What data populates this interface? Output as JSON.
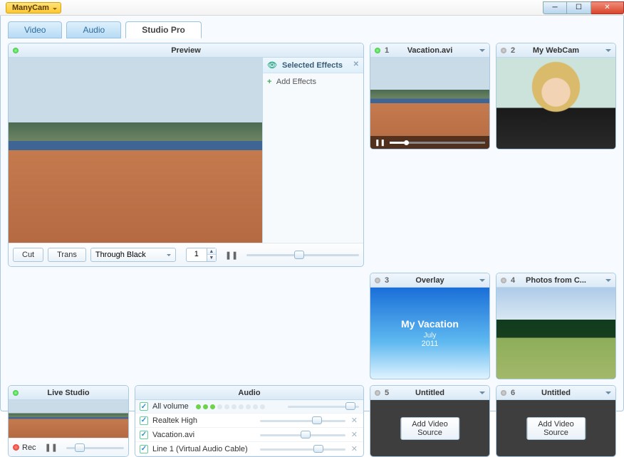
{
  "app": {
    "menu_label": "ManyCam"
  },
  "tabs": [
    {
      "label": "Video",
      "active": false
    },
    {
      "label": "Audio",
      "active": false
    },
    {
      "label": "Studio Pro",
      "active": true
    }
  ],
  "preview": {
    "title": "Preview",
    "effects": {
      "title": "Selected Effects",
      "add_label": "Add Effects"
    },
    "controls": {
      "cut": "Cut",
      "trans": "Trans",
      "transition_mode": "Through Black",
      "duration": "1"
    }
  },
  "sources": [
    {
      "num": "1",
      "title": "Vacation.avi",
      "active": true,
      "kind": "video"
    },
    {
      "num": "2",
      "title": "My WebCam",
      "active": false,
      "kind": "webcam"
    },
    {
      "num": "3",
      "title": "Overlay",
      "active": false,
      "kind": "overlay",
      "overlay": {
        "line1": "My Vacation",
        "line2": "July",
        "line3": "2011"
      }
    },
    {
      "num": "4",
      "title": "Photos from C...",
      "active": false,
      "kind": "photo"
    },
    {
      "num": "5",
      "title": "Untitled",
      "active": false,
      "kind": "empty",
      "button": "Add Video Source"
    },
    {
      "num": "6",
      "title": "Untitled",
      "active": false,
      "kind": "empty",
      "button": "Add Video Source"
    }
  ],
  "live": {
    "title": "Live Studio",
    "rec": "Rec"
  },
  "audio": {
    "title": "Audio",
    "all_label": "All volume",
    "channels": [
      {
        "label": "Realtek High",
        "pos": 0.68
      },
      {
        "label": "Vacation.avi",
        "pos": 0.55
      },
      {
        "label": "Line 1 (Virtual Audio Cable)",
        "pos": 0.7
      }
    ],
    "all_pos": 0.88,
    "vu_on": 3,
    "vu_total": 10
  }
}
